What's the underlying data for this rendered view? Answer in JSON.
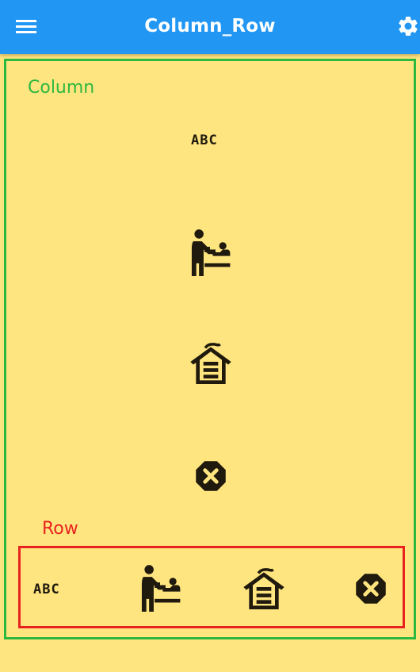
{
  "app_bar": {
    "title": "Column_Row",
    "menu_icon": "menu-icon",
    "settings_icon": "gear-icon",
    "color": "#2196f3"
  },
  "column": {
    "label": "Column",
    "label_color": "#2db840",
    "border_color": "#2db840",
    "icons": [
      "abc-icon",
      "baby-changing-station-icon",
      "garage-icon",
      "dangerous-icon"
    ],
    "abc_text": "ABC"
  },
  "row": {
    "label": "Row",
    "label_color": "#e8231f",
    "border_color": "#e8231f",
    "icons": [
      "abc-icon",
      "baby-changing-station-icon",
      "garage-icon",
      "dangerous-icon"
    ],
    "abc_text": "ABC"
  },
  "background_color": "#ffe57f"
}
